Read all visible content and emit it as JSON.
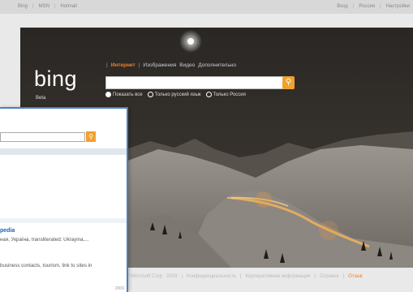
{
  "topbar": {
    "left_links": [
      "Bing",
      "MSN",
      "Hotmail"
    ],
    "right_links": [
      "Вход",
      "Россия",
      "Настройки"
    ]
  },
  "logo": {
    "text": "bing",
    "beta": "Beta"
  },
  "nav_tabs": [
    {
      "label": "Интернет",
      "active": true
    },
    {
      "label": "Изображения",
      "active": false
    },
    {
      "label": "Видео",
      "active": false
    },
    {
      "label": "Дополнительно",
      "active": false
    }
  ],
  "search": {
    "value": "",
    "button_icon": "search-icon"
  },
  "radios": [
    {
      "label": "Показать все",
      "checked": true
    },
    {
      "label": "Только русский язык",
      "checked": false
    },
    {
      "label": "Только Россия",
      "checked": false
    }
  ],
  "footer": {
    "links": [
      "© Microsoft Corp",
      "2009",
      "Конфиденциальность",
      "Корпоративная информация",
      "Справка",
      "Отзыв"
    ]
  },
  "overlay_panel": {
    "result_title": "pedia",
    "result_snippet_1": "ная, Україна, transliterated: Ukrayina,...",
    "result_snippet_2": "business contacts, tourism, link to sites in",
    "footer_text": "2009"
  },
  "colors": {
    "accent": "#f58220",
    "search_button": "#f0a22e",
    "panel_border": "#4a7fc0",
    "link_blue": "#1a5fb4"
  }
}
